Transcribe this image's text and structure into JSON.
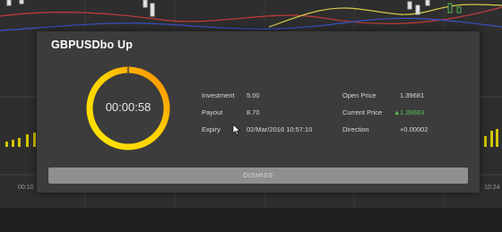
{
  "modal": {
    "title": "GBPUSDbo Up",
    "timer": "00:00:58",
    "fields": {
      "investment_label": "Investment",
      "investment_value": "5.00",
      "payout_label": "Payout",
      "payout_value": "8.70",
      "expiry_label": "Expiry",
      "expiry_value": "02/Mar/2016 10:57:10",
      "open_price_label": "Open Price",
      "open_price_value": "1.39681",
      "current_price_label": "Current Price",
      "current_price_arrow": "▲",
      "current_price_value": "1.39683",
      "direction_label": "Direction",
      "direction_value": "+0.00002"
    },
    "dismiss_label": "DISMISS"
  },
  "chart": {
    "time_left": "00:10",
    "time_right": "10:24"
  },
  "colors": {
    "modal_bg": "#3c3c3c",
    "timer_ring_start": "#ffe600",
    "timer_ring_end": "#ff8a00",
    "price_up": "#58c25a",
    "dismiss_bg": "#8f8f8f"
  },
  "icons": [
    "mouse-cursor-icon",
    "up-arrow-icon"
  ]
}
